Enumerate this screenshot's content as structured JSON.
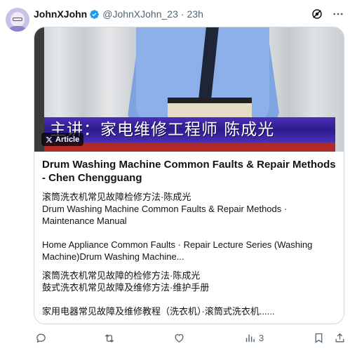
{
  "post": {
    "display_name": "JohnXJohn",
    "handle": "@JohnXJohn_23",
    "separator": "·",
    "time": "23h",
    "verified": true
  },
  "card": {
    "media_caption": "主讲：家电维修工程师 陈成光",
    "badge_label": "Article",
    "title": "Drum Washing Machine Common Faults & Repair Methods - Chen Chengguang",
    "paragraphs": [
      {
        "lines": [
          "滚筒洗衣机常见故障检修方法·陈成光",
          "Drum Washing Machine Common Faults & Repair Methods ·",
          "Maintenance Manual"
        ]
      },
      {
        "lines": [
          "Home Appliance Common Faults · Repair Lecture Series (Washing",
          "Machine)Drum Washing Machine..."
        ]
      },
      {
        "lines": [
          "滚筒洗衣机常见故障的检修方法·陈成光",
          "鼓式洗衣机常见故障及维修方法·维护手册"
        ]
      },
      {
        "lines": [
          "家用电器常见故障及维修教程（洗衣机）·滚筒式洗衣机......"
        ]
      }
    ]
  },
  "actions": {
    "reply_count": "",
    "repost_count": "",
    "like_count": "",
    "views_count": "3"
  },
  "icons": {
    "verified": "verified-badge-icon",
    "grok": "grok-icon",
    "more": "more-icon",
    "x_logo": "x-logo-icon",
    "reply": "reply-icon",
    "repost": "repost-icon",
    "like": "like-icon",
    "views": "views-icon",
    "bookmark": "bookmark-icon",
    "share": "share-icon"
  },
  "colors": {
    "accent": "#1d9bf0",
    "secondary_text": "#536471",
    "caption_band": "#3a24a0"
  }
}
